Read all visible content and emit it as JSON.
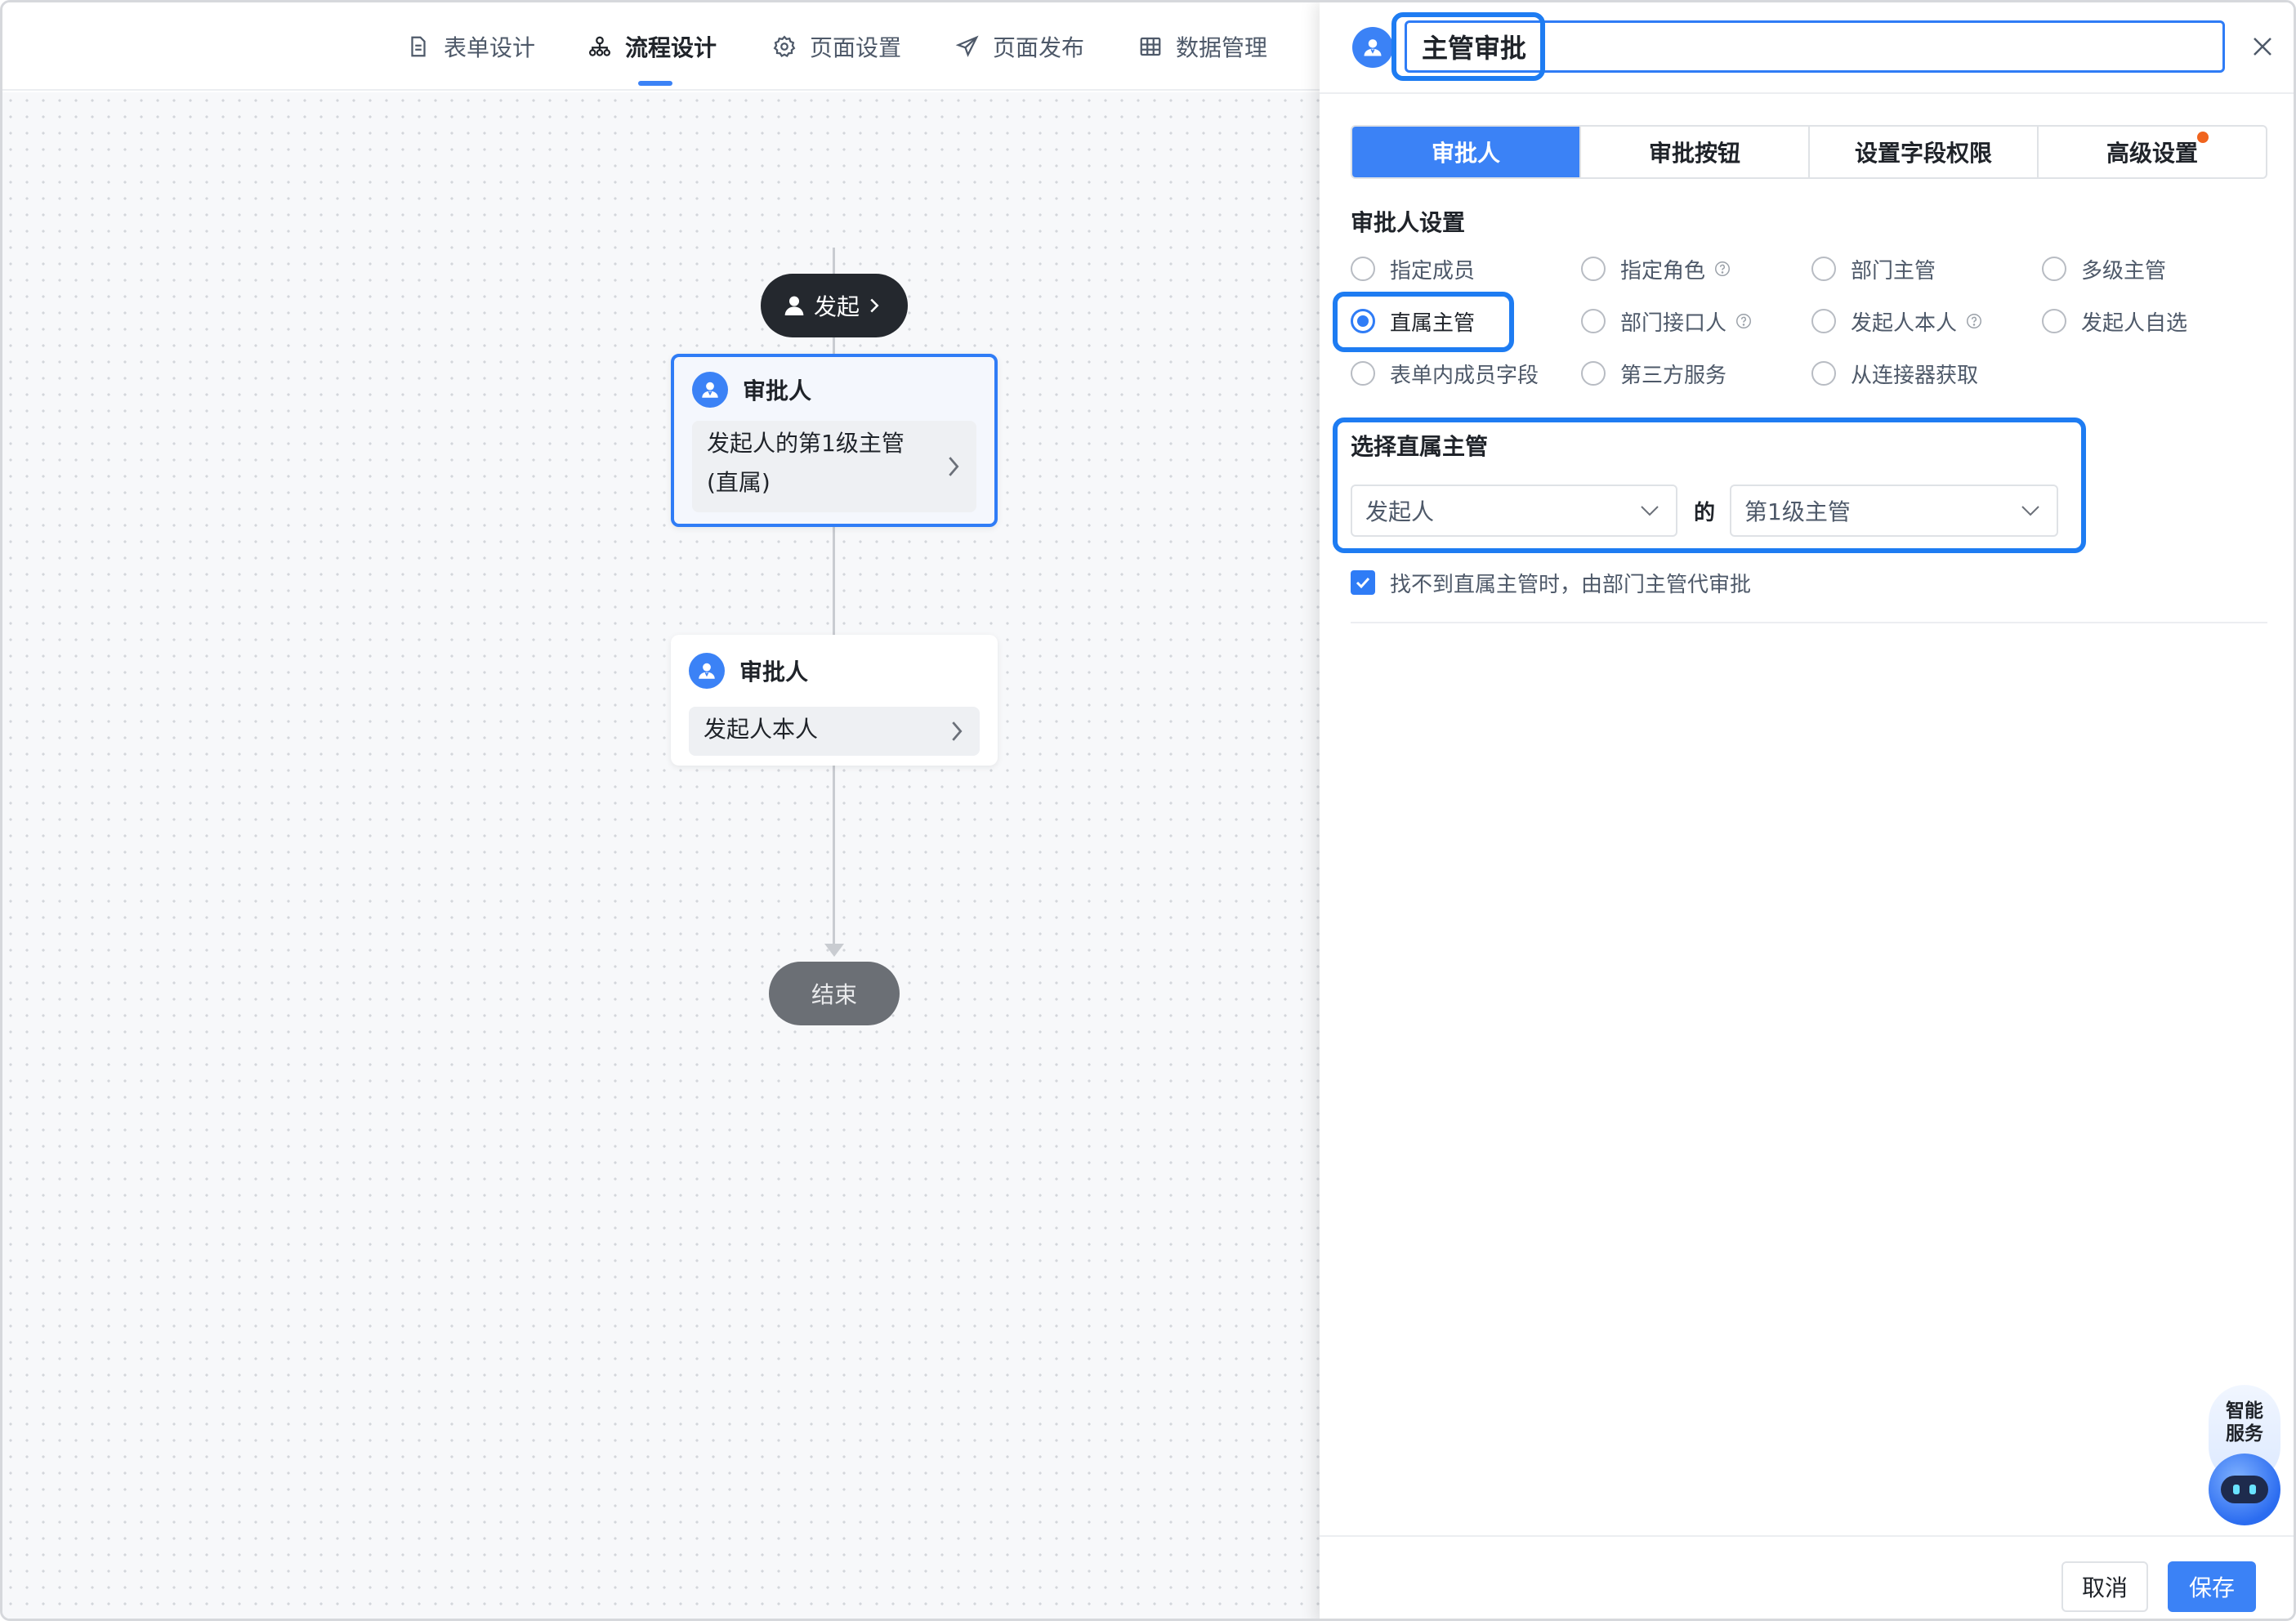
{
  "nav": {
    "items": [
      {
        "label": "表单设计",
        "icon": "document-icon"
      },
      {
        "label": "流程设计",
        "icon": "flow-icon"
      },
      {
        "label": "页面设置",
        "icon": "gear-icon"
      },
      {
        "label": "页面发布",
        "icon": "send-icon"
      },
      {
        "label": "数据管理",
        "icon": "table-icon"
      }
    ],
    "active_index": 1
  },
  "flow": {
    "start": {
      "label": "发起"
    },
    "nodes": [
      {
        "title": "审批人",
        "desc": "发起人的第1级主管 (直属)",
        "selected": true
      },
      {
        "title": "审批人",
        "desc": "发起人本人",
        "selected": false
      }
    ],
    "end": {
      "label": "结束"
    }
  },
  "panel": {
    "title_value": "主管审批",
    "tabs": [
      {
        "label": "审批人",
        "active": true
      },
      {
        "label": "审批按钮",
        "active": false
      },
      {
        "label": "设置字段权限",
        "active": false
      },
      {
        "label": "高级设置",
        "active": false,
        "has_dot": true
      }
    ],
    "approver_section_title": "审批人设置",
    "approver_options": [
      {
        "label": "指定成员",
        "help": false,
        "checked": false
      },
      {
        "label": "指定角色",
        "help": true,
        "checked": false
      },
      {
        "label": "部门主管",
        "help": false,
        "checked": false
      },
      {
        "label": "多级主管",
        "help": false,
        "checked": false
      },
      {
        "label": "直属主管",
        "help": false,
        "checked": true
      },
      {
        "label": "部门接口人",
        "help": true,
        "checked": false
      },
      {
        "label": "发起人本人",
        "help": true,
        "checked": false
      },
      {
        "label": "发起人自选",
        "help": false,
        "checked": false
      },
      {
        "label": "表单内成员字段",
        "help": false,
        "checked": false
      },
      {
        "label": "第三方服务",
        "help": false,
        "checked": false
      },
      {
        "label": "从连接器获取",
        "help": false,
        "checked": false
      }
    ],
    "direct_supervisor": {
      "title": "选择直属主管",
      "subject_value": "发起人",
      "connector": "的",
      "level_value": "第1级主管"
    },
    "fallback_checkbox": {
      "label": "找不到直属主管时，由部门主管代审批",
      "checked": true
    },
    "assistant_label": "智能服务",
    "footer": {
      "cancel": "取消",
      "save": "保存"
    }
  },
  "colors": {
    "accent": "#3b82f6",
    "highlight": "#1e7cf2",
    "dot": "#f0641e"
  }
}
